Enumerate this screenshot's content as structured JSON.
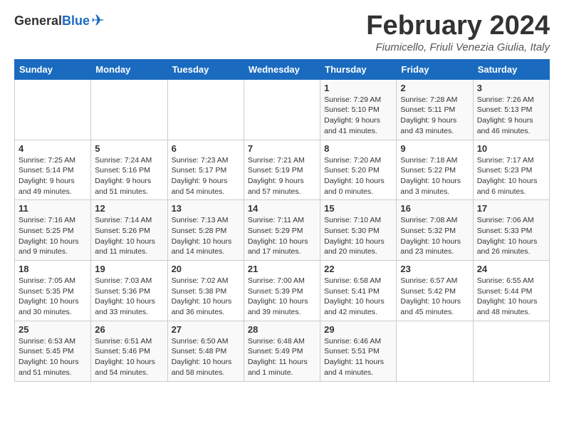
{
  "logo": {
    "text_general": "General",
    "text_blue": "Blue"
  },
  "header": {
    "month": "February 2024",
    "location": "Fiumicello, Friuli Venezia Giulia, Italy"
  },
  "days_of_week": [
    "Sunday",
    "Monday",
    "Tuesday",
    "Wednesday",
    "Thursday",
    "Friday",
    "Saturday"
  ],
  "weeks": [
    [
      {
        "day": "",
        "info": ""
      },
      {
        "day": "",
        "info": ""
      },
      {
        "day": "",
        "info": ""
      },
      {
        "day": "",
        "info": ""
      },
      {
        "day": "1",
        "info": "Sunrise: 7:29 AM\nSunset: 5:10 PM\nDaylight: 9 hours\nand 41 minutes."
      },
      {
        "day": "2",
        "info": "Sunrise: 7:28 AM\nSunset: 5:11 PM\nDaylight: 9 hours\nand 43 minutes."
      },
      {
        "day": "3",
        "info": "Sunrise: 7:26 AM\nSunset: 5:13 PM\nDaylight: 9 hours\nand 46 minutes."
      }
    ],
    [
      {
        "day": "4",
        "info": "Sunrise: 7:25 AM\nSunset: 5:14 PM\nDaylight: 9 hours\nand 49 minutes."
      },
      {
        "day": "5",
        "info": "Sunrise: 7:24 AM\nSunset: 5:16 PM\nDaylight: 9 hours\nand 51 minutes."
      },
      {
        "day": "6",
        "info": "Sunrise: 7:23 AM\nSunset: 5:17 PM\nDaylight: 9 hours\nand 54 minutes."
      },
      {
        "day": "7",
        "info": "Sunrise: 7:21 AM\nSunset: 5:19 PM\nDaylight: 9 hours\nand 57 minutes."
      },
      {
        "day": "8",
        "info": "Sunrise: 7:20 AM\nSunset: 5:20 PM\nDaylight: 10 hours\nand 0 minutes."
      },
      {
        "day": "9",
        "info": "Sunrise: 7:18 AM\nSunset: 5:22 PM\nDaylight: 10 hours\nand 3 minutes."
      },
      {
        "day": "10",
        "info": "Sunrise: 7:17 AM\nSunset: 5:23 PM\nDaylight: 10 hours\nand 6 minutes."
      }
    ],
    [
      {
        "day": "11",
        "info": "Sunrise: 7:16 AM\nSunset: 5:25 PM\nDaylight: 10 hours\nand 9 minutes."
      },
      {
        "day": "12",
        "info": "Sunrise: 7:14 AM\nSunset: 5:26 PM\nDaylight: 10 hours\nand 11 minutes."
      },
      {
        "day": "13",
        "info": "Sunrise: 7:13 AM\nSunset: 5:28 PM\nDaylight: 10 hours\nand 14 minutes."
      },
      {
        "day": "14",
        "info": "Sunrise: 7:11 AM\nSunset: 5:29 PM\nDaylight: 10 hours\nand 17 minutes."
      },
      {
        "day": "15",
        "info": "Sunrise: 7:10 AM\nSunset: 5:30 PM\nDaylight: 10 hours\nand 20 minutes."
      },
      {
        "day": "16",
        "info": "Sunrise: 7:08 AM\nSunset: 5:32 PM\nDaylight: 10 hours\nand 23 minutes."
      },
      {
        "day": "17",
        "info": "Sunrise: 7:06 AM\nSunset: 5:33 PM\nDaylight: 10 hours\nand 26 minutes."
      }
    ],
    [
      {
        "day": "18",
        "info": "Sunrise: 7:05 AM\nSunset: 5:35 PM\nDaylight: 10 hours\nand 30 minutes."
      },
      {
        "day": "19",
        "info": "Sunrise: 7:03 AM\nSunset: 5:36 PM\nDaylight: 10 hours\nand 33 minutes."
      },
      {
        "day": "20",
        "info": "Sunrise: 7:02 AM\nSunset: 5:38 PM\nDaylight: 10 hours\nand 36 minutes."
      },
      {
        "day": "21",
        "info": "Sunrise: 7:00 AM\nSunset: 5:39 PM\nDaylight: 10 hours\nand 39 minutes."
      },
      {
        "day": "22",
        "info": "Sunrise: 6:58 AM\nSunset: 5:41 PM\nDaylight: 10 hours\nand 42 minutes."
      },
      {
        "day": "23",
        "info": "Sunrise: 6:57 AM\nSunset: 5:42 PM\nDaylight: 10 hours\nand 45 minutes."
      },
      {
        "day": "24",
        "info": "Sunrise: 6:55 AM\nSunset: 5:44 PM\nDaylight: 10 hours\nand 48 minutes."
      }
    ],
    [
      {
        "day": "25",
        "info": "Sunrise: 6:53 AM\nSunset: 5:45 PM\nDaylight: 10 hours\nand 51 minutes."
      },
      {
        "day": "26",
        "info": "Sunrise: 6:51 AM\nSunset: 5:46 PM\nDaylight: 10 hours\nand 54 minutes."
      },
      {
        "day": "27",
        "info": "Sunrise: 6:50 AM\nSunset: 5:48 PM\nDaylight: 10 hours\nand 58 minutes."
      },
      {
        "day": "28",
        "info": "Sunrise: 6:48 AM\nSunset: 5:49 PM\nDaylight: 11 hours\nand 1 minute."
      },
      {
        "day": "29",
        "info": "Sunrise: 6:46 AM\nSunset: 5:51 PM\nDaylight: 11 hours\nand 4 minutes."
      },
      {
        "day": "",
        "info": ""
      },
      {
        "day": "",
        "info": ""
      }
    ]
  ]
}
